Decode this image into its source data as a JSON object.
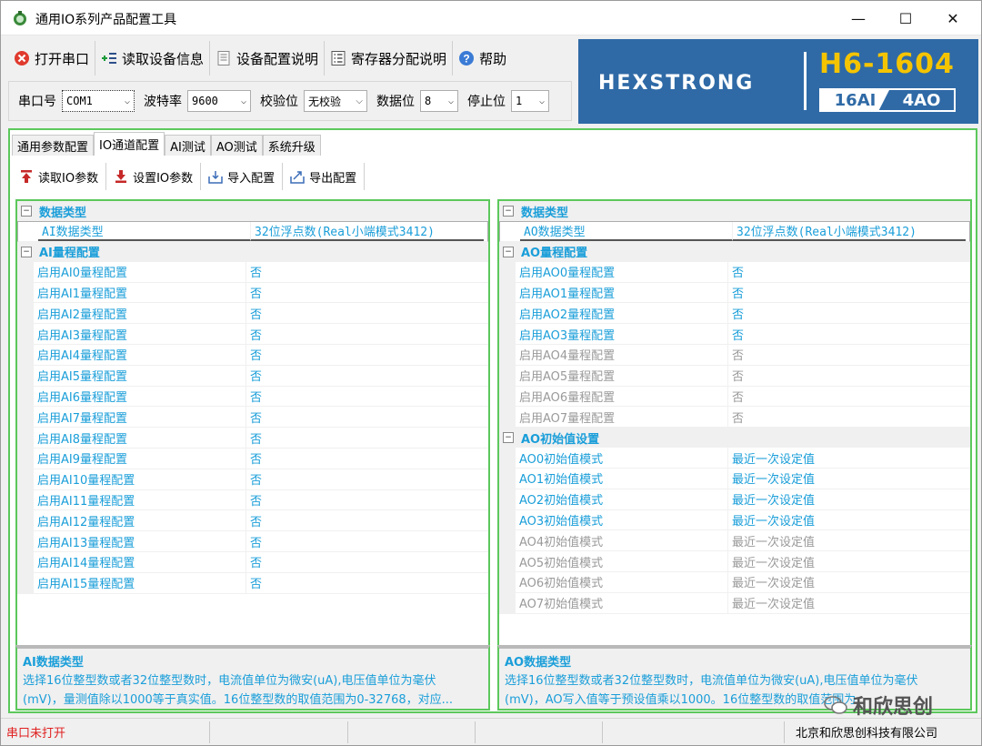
{
  "window": {
    "title": "通用IO系列产品配置工具",
    "min": "—",
    "max": "☐",
    "close": "✕"
  },
  "toolbar": {
    "items": [
      {
        "label": "打开串口",
        "icon": "error-circle-icon"
      },
      {
        "label": "读取设备信息",
        "icon": "add-list-icon"
      },
      {
        "label": "设备配置说明",
        "icon": "document-icon"
      },
      {
        "label": "寄存器分配说明",
        "icon": "register-list-icon"
      },
      {
        "label": "帮助",
        "icon": "help-icon"
      }
    ]
  },
  "settings": {
    "port": {
      "label": "串口号",
      "value": "COM1"
    },
    "baud": {
      "label": "波特率",
      "value": "9600"
    },
    "parity": {
      "label": "校验位",
      "value": "无校验"
    },
    "databits": {
      "label": "数据位",
      "value": "8"
    },
    "stopbits": {
      "label": "停止位",
      "value": "1"
    }
  },
  "banner": {
    "brand": "HEXSTRONG",
    "model": "H6-1604",
    "spec_a": "16AI",
    "spec_b": "4AO",
    "bg": "#2f6aa6",
    "accent": "#f5c400"
  },
  "tabs": [
    "通用参数配置",
    "IO通道配置",
    "AI测试",
    "AO测试",
    "系统升级"
  ],
  "subtoolbar": [
    {
      "label": "读取IO参数",
      "icon": "read-arrow-icon"
    },
    {
      "label": "设置IO参数",
      "icon": "write-arrow-icon"
    },
    {
      "label": "导入配置",
      "icon": "import-icon"
    },
    {
      "label": "导出配置",
      "icon": "export-icon"
    }
  ],
  "left_grid": {
    "cat1": "数据类型",
    "type_row": {
      "name": "AI数据类型",
      "value": "32位浮点数(Real小端模式3412)"
    },
    "cat2": "AI量程配置",
    "rows": [
      {
        "name": "启用AI0量程配置",
        "value": "否"
      },
      {
        "name": "启用AI1量程配置",
        "value": "否"
      },
      {
        "name": "启用AI2量程配置",
        "value": "否"
      },
      {
        "name": "启用AI3量程配置",
        "value": "否"
      },
      {
        "name": "启用AI4量程配置",
        "value": "否"
      },
      {
        "name": "启用AI5量程配置",
        "value": "否"
      },
      {
        "name": "启用AI6量程配置",
        "value": "否"
      },
      {
        "name": "启用AI7量程配置",
        "value": "否"
      },
      {
        "name": "启用AI8量程配置",
        "value": "否"
      },
      {
        "name": "启用AI9量程配置",
        "value": "否"
      },
      {
        "name": "启用AI10量程配置",
        "value": "否"
      },
      {
        "name": "启用AI11量程配置",
        "value": "否"
      },
      {
        "name": "启用AI12量程配置",
        "value": "否"
      },
      {
        "name": "启用AI13量程配置",
        "value": "否"
      },
      {
        "name": "启用AI14量程配置",
        "value": "否"
      },
      {
        "name": "启用AI15量程配置",
        "value": "否"
      }
    ]
  },
  "right_grid": {
    "cat1": "数据类型",
    "type_row": {
      "name": "AO数据类型",
      "value": "32位浮点数(Real小端模式3412)"
    },
    "cat2": "AO量程配置",
    "range_rows": [
      {
        "name": "启用AO0量程配置",
        "value": "否",
        "enabled": true
      },
      {
        "name": "启用AO1量程配置",
        "value": "否",
        "enabled": true
      },
      {
        "name": "启用AO2量程配置",
        "value": "否",
        "enabled": true
      },
      {
        "name": "启用AO3量程配置",
        "value": "否",
        "enabled": true
      },
      {
        "name": "启用AO4量程配置",
        "value": "否",
        "enabled": false
      },
      {
        "name": "启用AO5量程配置",
        "value": "否",
        "enabled": false
      },
      {
        "name": "启用AO6量程配置",
        "value": "否",
        "enabled": false
      },
      {
        "name": "启用AO7量程配置",
        "value": "否",
        "enabled": false
      }
    ],
    "cat3": "AO初始值设置",
    "init_rows": [
      {
        "name": "AO0初始值模式",
        "value": "最近一次设定值",
        "enabled": true
      },
      {
        "name": "AO1初始值模式",
        "value": "最近一次设定值",
        "enabled": true
      },
      {
        "name": "AO2初始值模式",
        "value": "最近一次设定值",
        "enabled": true
      },
      {
        "name": "AO3初始值模式",
        "value": "最近一次设定值",
        "enabled": true
      },
      {
        "name": "AO4初始值模式",
        "value": "最近一次设定值",
        "enabled": false
      },
      {
        "name": "AO5初始值模式",
        "value": "最近一次设定值",
        "enabled": false
      },
      {
        "name": "AO6初始值模式",
        "value": "最近一次设定值",
        "enabled": false
      },
      {
        "name": "AO7初始值模式",
        "value": "最近一次设定值",
        "enabled": false
      }
    ]
  },
  "desc_left": {
    "title": "AI数据类型",
    "line1": "选择16位整型数或者32位整型数时，电流值单位为微安(uA),电压值单位为毫伏",
    "line2": "(mV)，量测值除以1000等于真实值。16位整型数的取值范围为0-32768，对应..."
  },
  "desc_right": {
    "title": "AO数据类型",
    "line1": "选择16位整型数或者32位整型数时，电流值单位为微安(uA),电压值单位为毫伏",
    "line2": "(mV)，AO写入值等于预设值乘以1000。16位整型数的取值范围为"
  },
  "status": {
    "port_state": "串口未打开",
    "company": "北京和欣思创科技有限公司"
  },
  "watermark": "和欣思创"
}
